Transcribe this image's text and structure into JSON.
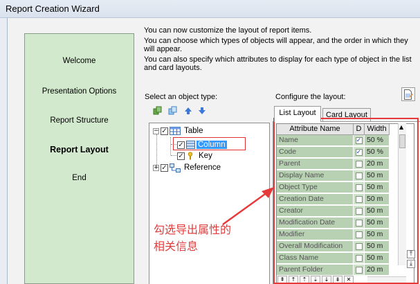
{
  "window": {
    "title": "Report Creation Wizard"
  },
  "nav": {
    "items": [
      {
        "label": "Welcome",
        "active": false
      },
      {
        "label": "Presentation Options",
        "active": false
      },
      {
        "label": "Report Structure",
        "active": false
      },
      {
        "label": "Report Layout",
        "active": true
      },
      {
        "label": "End",
        "active": false
      }
    ]
  },
  "intro": {
    "line1": "You can now customize the layout of report items.",
    "line2": "You can choose which types of objects will appear, and the order in which they will appear.",
    "line3": "You can also specify which attributes to display for each type of object in the list and card layouts."
  },
  "left": {
    "select_label": "Select an object type:"
  },
  "tree": {
    "table": "Table",
    "column": "Column",
    "key": "Key",
    "reference": "Reference"
  },
  "right": {
    "configure_label": "Configure the layout:"
  },
  "tabs": {
    "list": "List Layout",
    "card": "Card Layout"
  },
  "grid": {
    "headers": {
      "name": "Attribute Name",
      "d": "D",
      "width": "Width"
    },
    "rows": [
      {
        "name": "Name",
        "checked": true,
        "width": "50 %"
      },
      {
        "name": "Code",
        "checked": true,
        "width": "50 %"
      },
      {
        "name": "Parent",
        "checked": false,
        "width": "20 m"
      },
      {
        "name": "Display Name",
        "checked": false,
        "width": "50 m"
      },
      {
        "name": "Object Type",
        "checked": false,
        "width": "50 m"
      },
      {
        "name": "Creation Date",
        "checked": false,
        "width": "50 m"
      },
      {
        "name": "Creator",
        "checked": false,
        "width": "50 m"
      },
      {
        "name": "Modification Date",
        "checked": false,
        "width": "50 m"
      },
      {
        "name": "Modifier",
        "checked": false,
        "width": "50 m"
      },
      {
        "name": "Overall Modification",
        "checked": false,
        "width": "50 m"
      },
      {
        "name": "Class Name",
        "checked": false,
        "width": "50 m"
      },
      {
        "name": "Parent Folder",
        "checked": false,
        "width": "20 m"
      }
    ]
  },
  "annotation": {
    "line1": "勾选导出属性的",
    "line2": "相关信息"
  },
  "colors": {
    "nav_bg": "#d2e9cd",
    "grid_cell": "#b7d1b2",
    "selection": "#3399ff",
    "annotation_red": "#e33c3c"
  }
}
